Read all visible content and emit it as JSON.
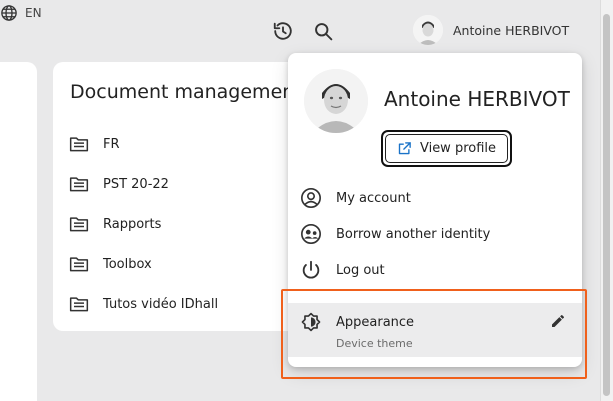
{
  "header": {
    "history_icon": "history-icon",
    "search_icon": "search-icon",
    "language": {
      "icon": "globe-icon",
      "code": "EN"
    },
    "user_name": "Antoine HERBIVOT"
  },
  "documents": {
    "title": "Document management",
    "folder_icon": "folder-icon",
    "folders": [
      {
        "label": "FR"
      },
      {
        "label": "PST 20-22"
      },
      {
        "label": "Rapports"
      },
      {
        "label": "Toolbox"
      },
      {
        "label": "Tutos vidéo IDhall"
      }
    ]
  },
  "user_menu": {
    "name": "Antoine HERBIVOT",
    "view_profile_label": "View profile",
    "items": [
      {
        "label": "My account",
        "icon": "account-circle-icon"
      },
      {
        "label": "Borrow another identity",
        "icon": "switch-identity-icon"
      },
      {
        "label": "Log out",
        "icon": "power-icon"
      }
    ],
    "appearance": {
      "label": "Appearance",
      "value": "Device theme",
      "icon": "brightness-icon",
      "edit_icon": "pencil-icon"
    }
  },
  "colors": {
    "background": "#e9e9ea",
    "card": "#ffffff",
    "highlight": "#f0601b",
    "hover": "#ececed"
  }
}
